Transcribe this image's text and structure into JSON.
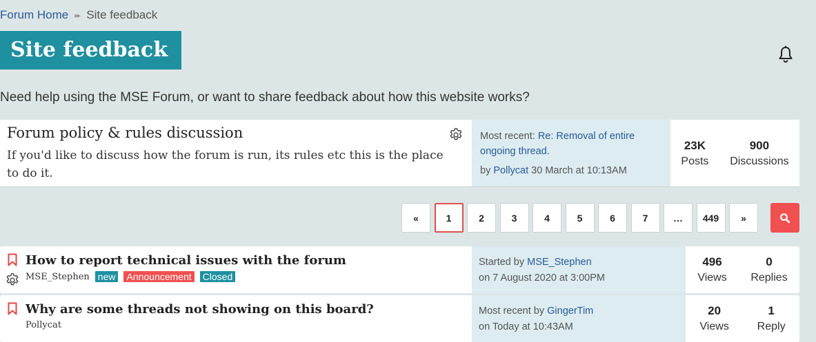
{
  "breadcrumb": {
    "home": "Forum Home",
    "separator": "▸▸",
    "current": "Site feedback"
  },
  "page_title": "Site feedback",
  "description": "Need help using the MSE Forum, or want to share feedback about how this website works?",
  "category": {
    "title": "Forum policy & rules discussion",
    "description": "If you'd like to discuss how the forum is run, its rules etc this is the place to do it.",
    "recent_prefix": "Most recent:",
    "recent_link": "Re: Removal of entire ongoing thread.",
    "by_prefix": "by",
    "by_user": "Pollycat",
    "by_date": "30 March at 10:13AM",
    "posts_num": "23K",
    "posts_label": "Posts",
    "discussions_num": "900",
    "discussions_label": "Discussions"
  },
  "pager": {
    "prev": "«",
    "pages": [
      "1",
      "2",
      "3",
      "4",
      "5",
      "6",
      "7",
      "…",
      "449"
    ],
    "next": "»",
    "active": "1"
  },
  "threads": [
    {
      "title": "How to report technical issues with the forum",
      "author": "MSE_Stephen",
      "badges": {
        "new": "new",
        "announcement": "Announcement",
        "closed": "Closed"
      },
      "recent_prefix": "Started by",
      "recent_user": "MSE_Stephen",
      "recent_date": "on 7 August 2020 at 3:00PM",
      "views_num": "496",
      "views_label": "Views",
      "replies_num": "0",
      "replies_label": "Replies"
    },
    {
      "title": "Why are some threads not showing on this board?",
      "author": "Pollycat",
      "recent_prefix": "Most recent by",
      "recent_user": "GingerTim",
      "recent_date": "on Today at 10:43AM",
      "views_num": "20",
      "views_label": "Views",
      "replies_num": "1",
      "replies_label": "Reply"
    }
  ],
  "colors": {
    "accent": "#1e90a0",
    "alert": "#f05050",
    "link": "#2a5a9a",
    "background": "#dde6e6"
  }
}
